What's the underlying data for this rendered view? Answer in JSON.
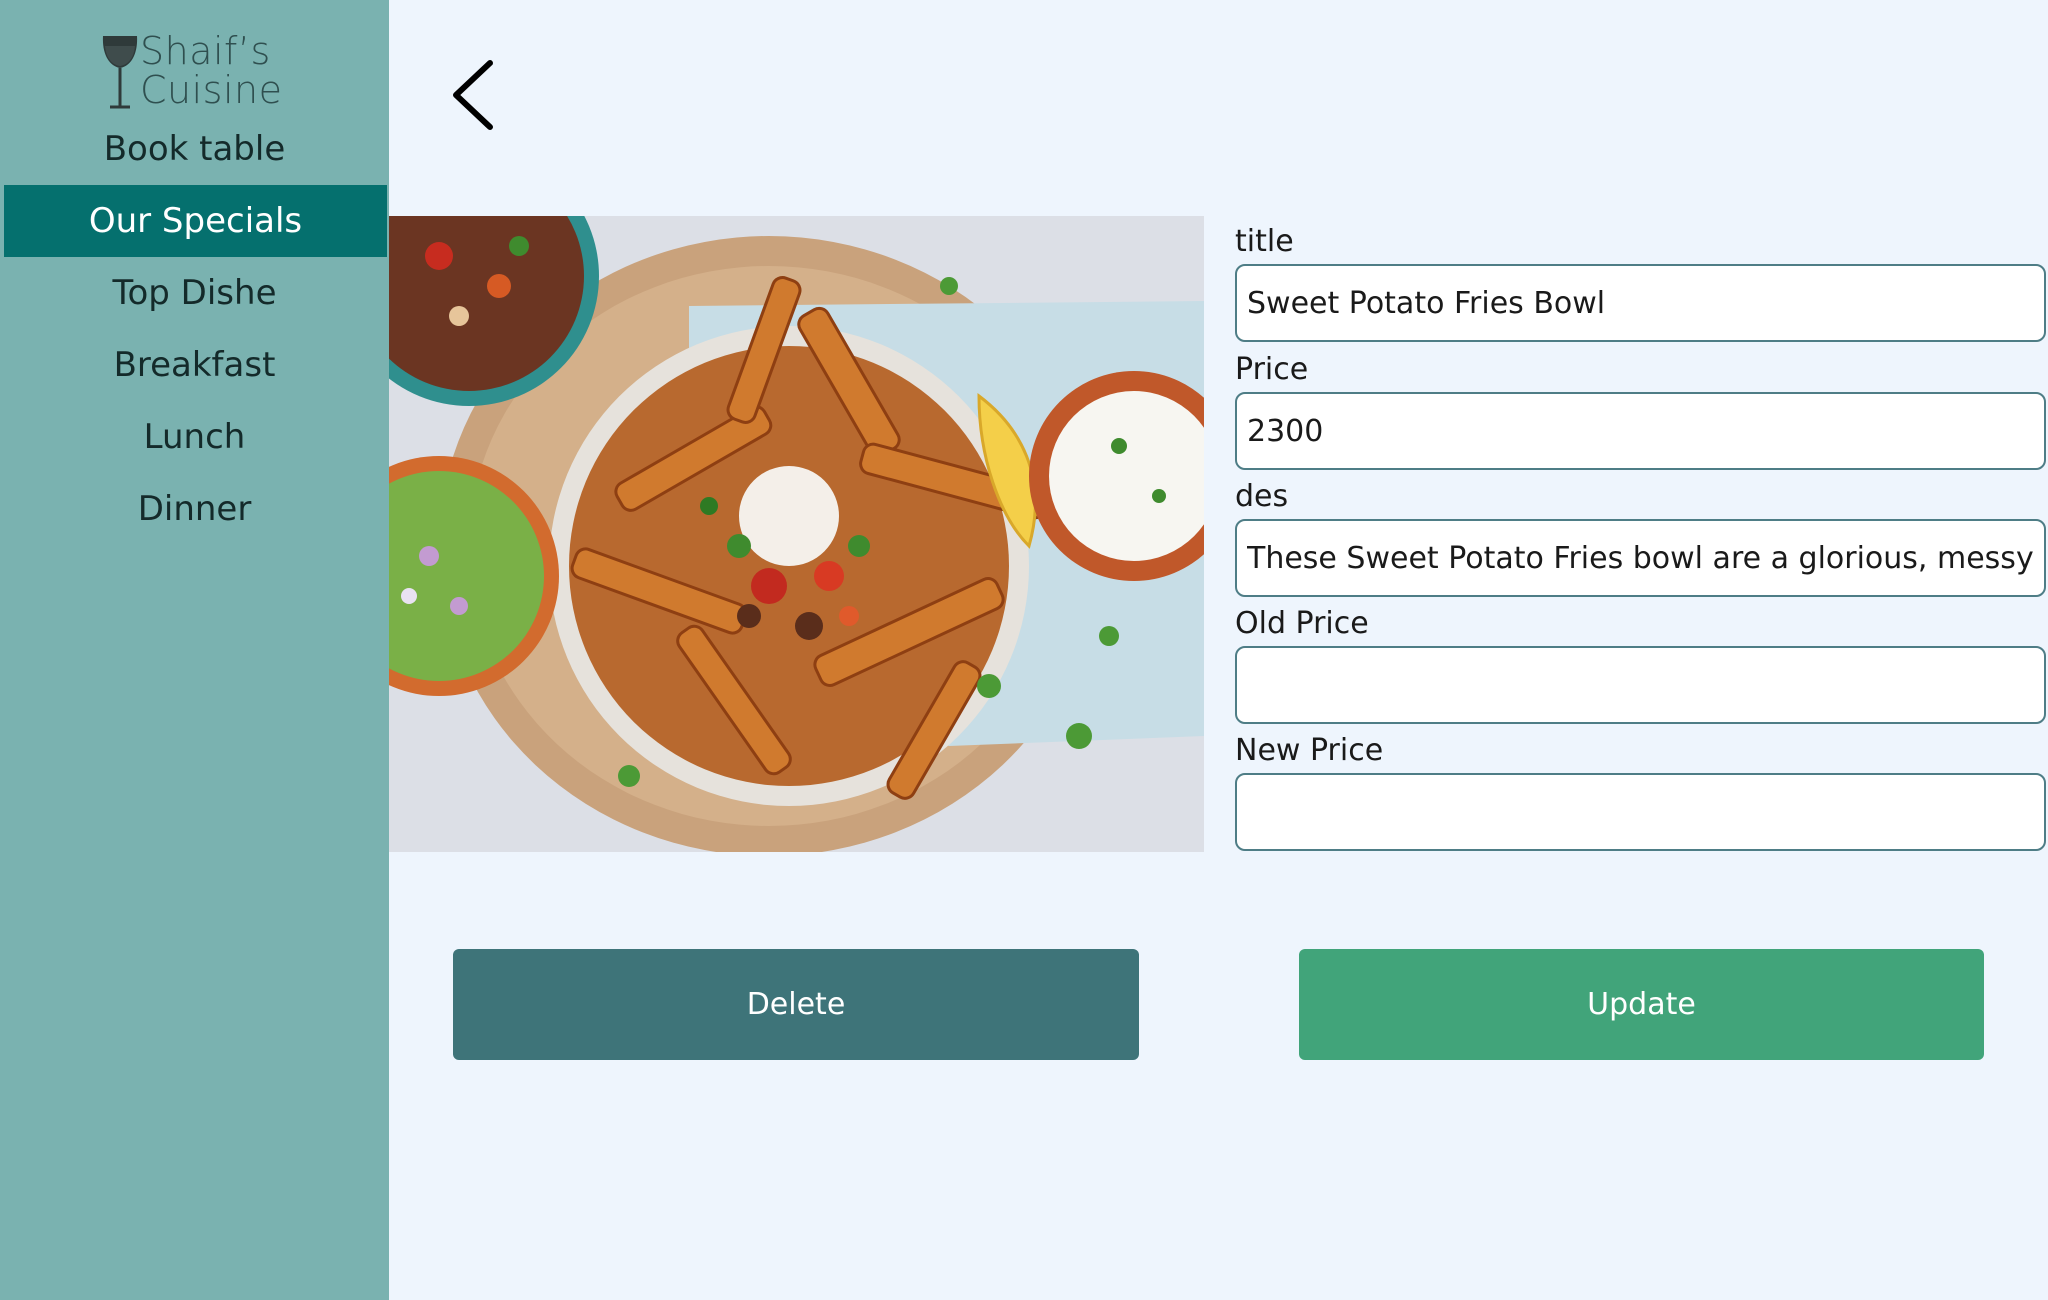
{
  "brand": {
    "name_line1": "Shaif’s",
    "name_line2": "Cuisine"
  },
  "sidebar": {
    "items": [
      {
        "label": "Book table"
      },
      {
        "label": "Our Specials"
      },
      {
        "label": "Top Dishe"
      },
      {
        "label": "Breakfast"
      },
      {
        "label": "Lunch"
      },
      {
        "label": "Dinner"
      }
    ],
    "active_index": 1
  },
  "header": {
    "back_icon": "chevron-left-icon"
  },
  "form": {
    "title_label": "title",
    "title_value": "Sweet Potato Fries Bowl",
    "price_label": "Price",
    "price_value": "2300",
    "des_label": "des",
    "des_value": "These Sweet Potato Fries bowl are a glorious, messy plat",
    "old_price_label": "Old Price",
    "old_price_value": "",
    "new_price_label": "New Price",
    "new_price_value": ""
  },
  "actions": {
    "delete_label": "Delete",
    "update_label": "Update"
  },
  "colors": {
    "sidebar_bg": "#7ab2b0",
    "sidebar_active": "#05706e",
    "page_bg": "#eef5fd",
    "delete_button": "#3e7479",
    "update_button": "#41a47a",
    "input_border": "#4e7d86"
  }
}
